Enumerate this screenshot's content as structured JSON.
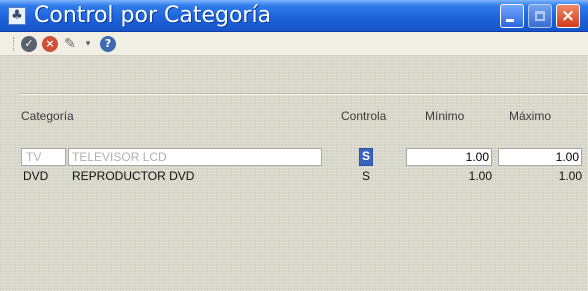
{
  "window": {
    "title": "Control por Categoría",
    "buttons": {
      "minimize_icon": "minimize-icon",
      "maximize_icon": "maximize-icon",
      "close_icon": "close-icon",
      "close_glyph": "×"
    }
  },
  "toolbar": {
    "items": [
      {
        "name": "accept-icon",
        "glyph": "✓"
      },
      {
        "name": "cancel-icon",
        "glyph": "×"
      },
      {
        "name": "brush-icon",
        "glyph": "✎"
      },
      {
        "name": "dropdown-icon",
        "glyph": "▾"
      },
      {
        "name": "help-icon",
        "glyph": "?"
      }
    ]
  },
  "table": {
    "headers": {
      "category": "Categoría",
      "controls": "Controla",
      "minimum": "Mínimo",
      "maximum": "Máximo"
    },
    "rows": [
      {
        "code": "TV",
        "description": "TELEVISOR LCD",
        "controls": "S",
        "minimum": "1.00",
        "maximum": "1.00"
      },
      {
        "code": "DVD",
        "description": "REPRODUCTOR DVD",
        "controls": "S",
        "minimum": "1.00",
        "maximum": "1.00"
      }
    ]
  },
  "colors": {
    "title_bar": "#1e63d9",
    "selected_control": "#3a64b7",
    "window_background": "#d9d8cb"
  }
}
